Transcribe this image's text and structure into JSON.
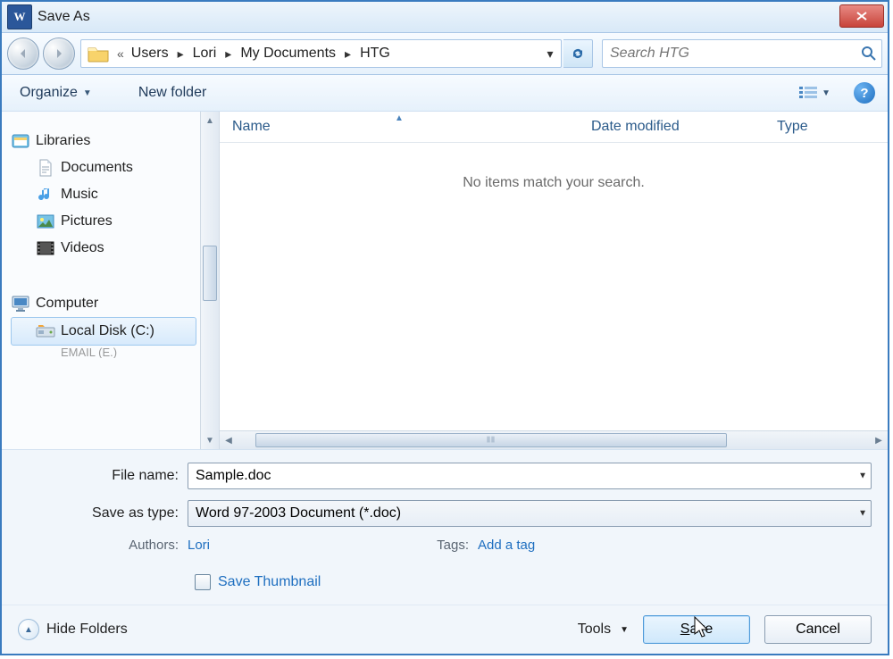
{
  "window": {
    "title": "Save As"
  },
  "breadcrumbs": {
    "prefix_sep": "«",
    "arrow": "▸",
    "items": [
      "Users",
      "Lori",
      "My Documents",
      "HTG"
    ]
  },
  "search": {
    "placeholder": "Search HTG"
  },
  "toolbar": {
    "organize": "Organize",
    "newfolder": "New folder"
  },
  "columns": {
    "name": "Name",
    "date": "Date modified",
    "type": "Type"
  },
  "empty_message": "No items match your search.",
  "sidebar": {
    "libraries": {
      "label": "Libraries",
      "items": [
        "Documents",
        "Music",
        "Pictures",
        "Videos"
      ]
    },
    "computer": {
      "label": "Computer",
      "drive": "Local Disk (C:)",
      "cutoff": "EMAIL (E.)"
    }
  },
  "form": {
    "filename_label": "File name:",
    "filename_value": "Sample.doc",
    "type_label": "Save as type:",
    "type_value": "Word 97-2003 Document (*.doc)",
    "authors_label": "Authors:",
    "authors_value": "Lori",
    "tags_label": "Tags:",
    "tags_placeholder": "Add a tag",
    "save_thumb": "Save Thumbnail"
  },
  "footer": {
    "hide_folders": "Hide Folders",
    "tools": "Tools",
    "save": "Save",
    "cancel": "Cancel"
  }
}
